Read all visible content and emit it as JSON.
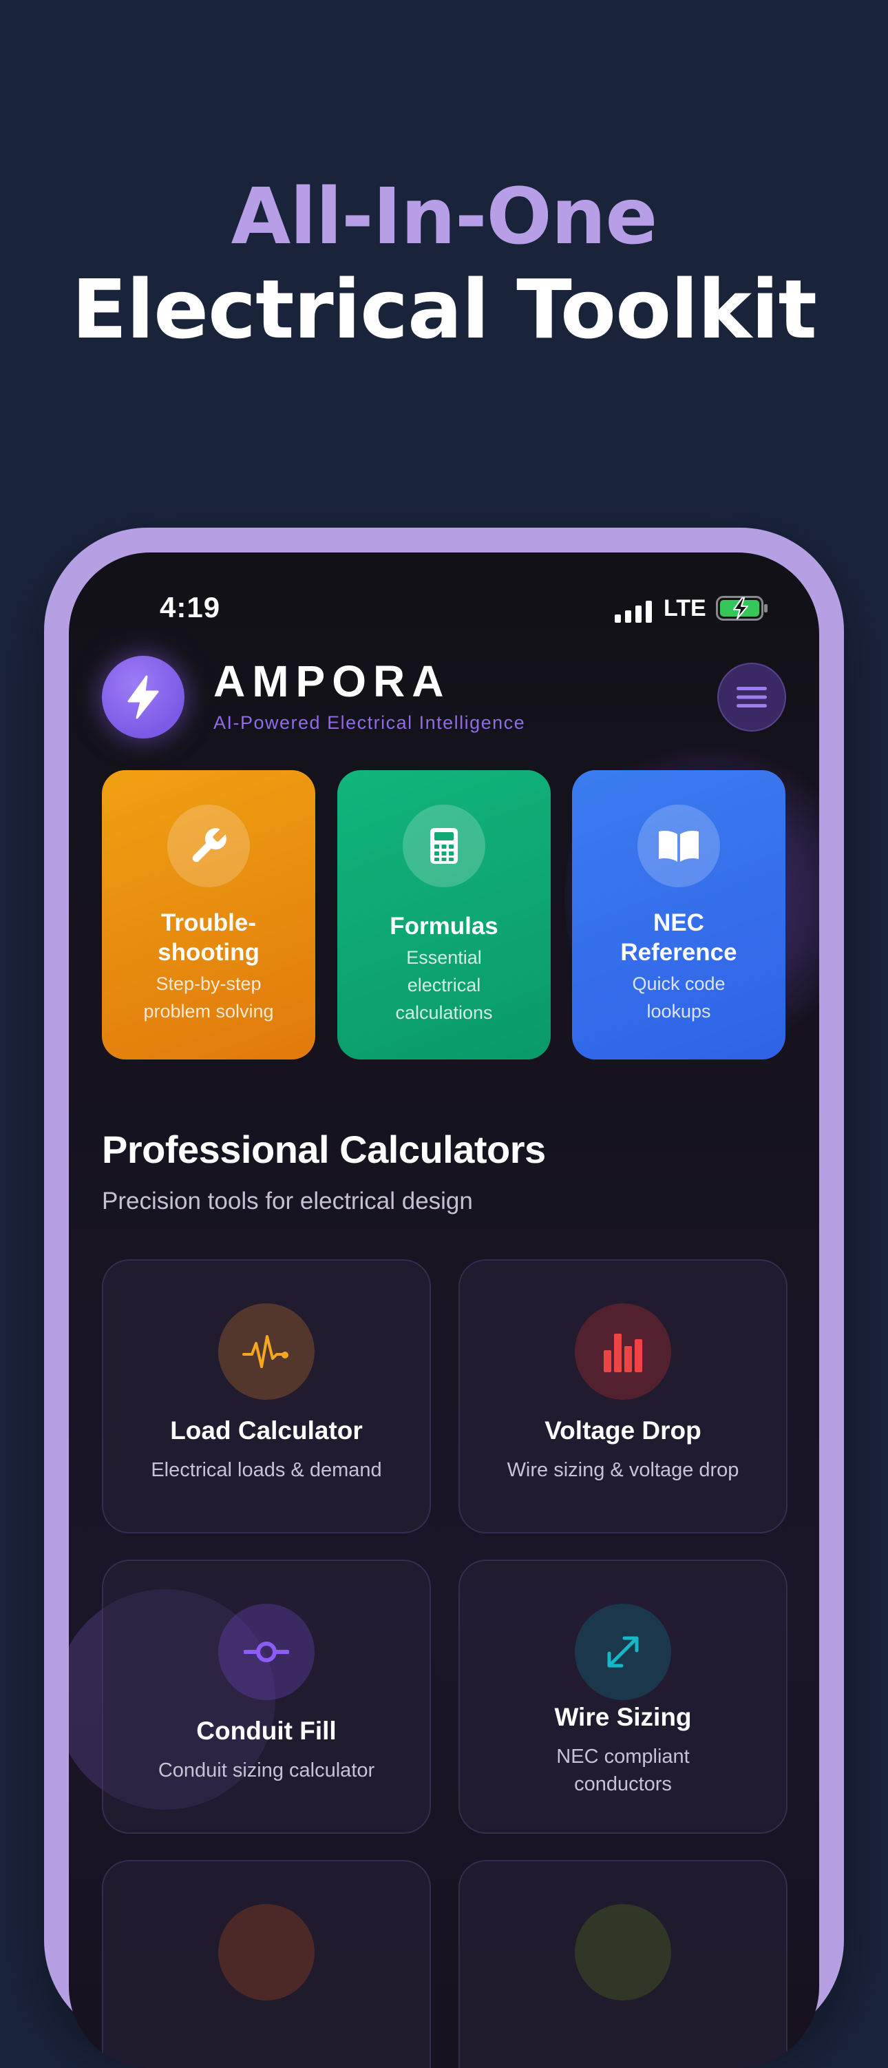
{
  "hero": {
    "line1": "All-In-One",
    "line2": "Electrical Toolkit"
  },
  "status_bar": {
    "time": "4:19",
    "network": "LTE"
  },
  "header": {
    "app_name": "AMPORA",
    "tagline": "AI-Powered Electrical Intelligence"
  },
  "quick_actions": [
    {
      "title": "Trouble-\nshooting",
      "desc": "Step-by-step\nproblem solving",
      "icon": "wrench-icon",
      "color": "#f0a012"
    },
    {
      "title": "Formulas",
      "desc": "Essential\nelectrical\ncalculations",
      "icon": "calculator-icon",
      "color": "#12b47c"
    },
    {
      "title": "NEC\nReference",
      "desc": "Quick code\nlookups",
      "icon": "book-icon",
      "color": "#3b7cf0"
    }
  ],
  "section": {
    "title": "Professional Calculators",
    "subtitle": "Precision tools for electrical design"
  },
  "calculators": [
    {
      "title": "Load Calculator",
      "desc": "Electrical loads & demand",
      "icon": "pulse-icon",
      "color": "#f5a623"
    },
    {
      "title": "Voltage Drop",
      "desc": "Wire sizing & voltage drop",
      "icon": "bar-chart-icon",
      "color": "#ef4444"
    },
    {
      "title": "Conduit Fill",
      "desc": "Conduit sizing calculator",
      "icon": "commit-icon",
      "color": "#8b5cf6"
    },
    {
      "title": "Wire Sizing",
      "desc": "NEC compliant\nconductors",
      "icon": "resize-icon",
      "color": "#14b8c8"
    }
  ],
  "colors": {
    "background": "#19233a",
    "accent": "#b79fe3",
    "brand": "#7d5ae6"
  }
}
